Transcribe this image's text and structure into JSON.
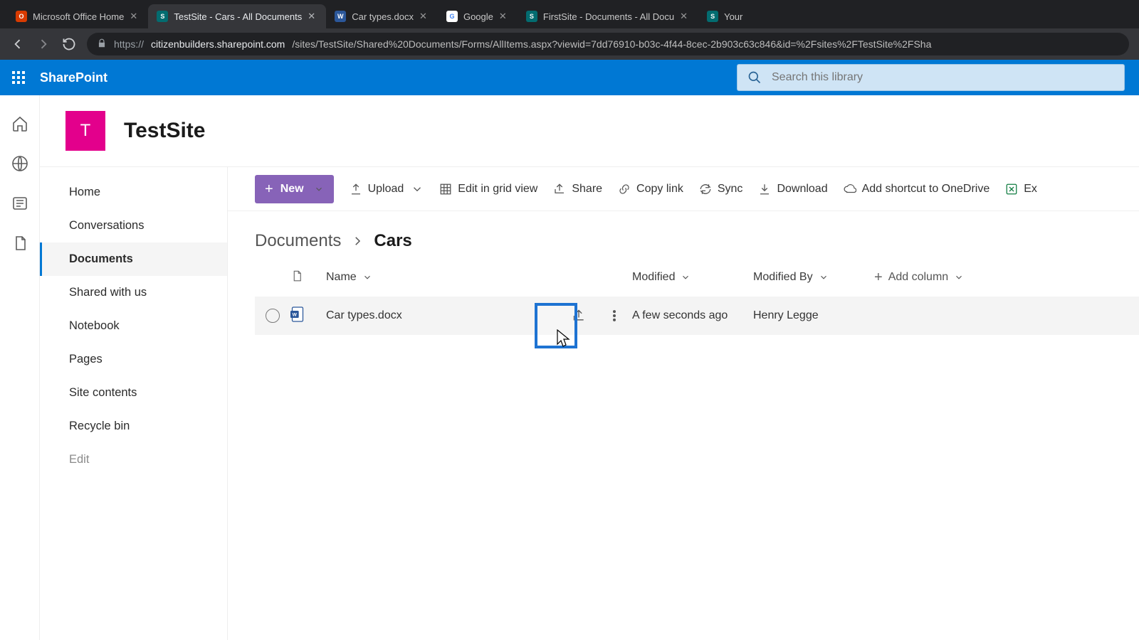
{
  "browser": {
    "tabs": [
      {
        "label": "Microsoft Office Home",
        "fav": "office"
      },
      {
        "label": "TestSite - Cars - All Documents",
        "fav": "sp",
        "active": true
      },
      {
        "label": "Car types.docx",
        "fav": "word"
      },
      {
        "label": "Google",
        "fav": "google"
      },
      {
        "label": "FirstSite - Documents - All Docu",
        "fav": "sp"
      },
      {
        "label": "Your",
        "fav": "sp"
      }
    ],
    "url_host": "citizenbuilders.sharepoint.com",
    "url_path": "/sites/TestSite/Shared%20Documents/Forms/AllItems.aspx?viewid=7dd76910-b03c-4f44-8cec-2b903c63c846&id=%2Fsites%2FTestSite%2FSha",
    "url_prefix": "https://"
  },
  "suite": {
    "brand": "SharePoint",
    "search_placeholder": "Search this library"
  },
  "site": {
    "logo_letter": "T",
    "title": "TestSite"
  },
  "nav": {
    "items": [
      "Home",
      "Conversations",
      "Documents",
      "Shared with us",
      "Notebook",
      "Pages",
      "Site contents",
      "Recycle bin"
    ],
    "edit": "Edit",
    "selected_index": 2
  },
  "commands": {
    "new": "New",
    "upload": "Upload",
    "edit_grid": "Edit in grid view",
    "share": "Share",
    "copylink": "Copy link",
    "sync": "Sync",
    "download": "Download",
    "shortcut": "Add shortcut to OneDrive",
    "excel": "Ex"
  },
  "breadcrumb": {
    "root": "Documents",
    "leaf": "Cars"
  },
  "columns": {
    "name": "Name",
    "modified": "Modified",
    "modified_by": "Modified By",
    "add": "Add column"
  },
  "rows": [
    {
      "name": "Car types.docx",
      "modified": "A few seconds ago",
      "modified_by": "Henry Legge"
    }
  ],
  "colors": {
    "accent": "#0078d4",
    "new_btn": "#8763b8",
    "site_logo": "#e3008c",
    "highlight": "#1e73d2"
  }
}
